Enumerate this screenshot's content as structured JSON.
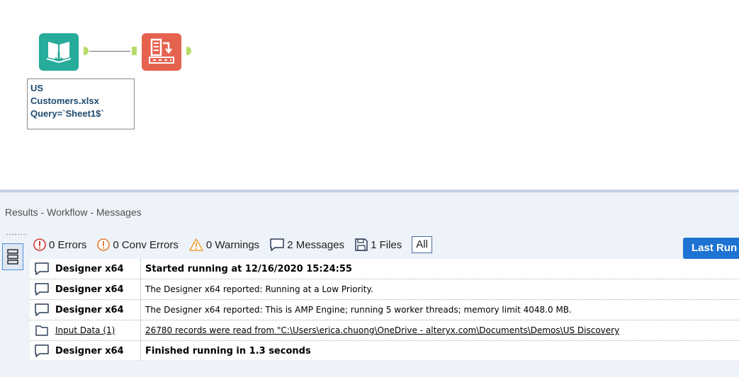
{
  "canvas": {
    "tools": [
      {
        "name": "input-data-tool",
        "color": "#27ab9a"
      },
      {
        "name": "select-tool",
        "color": "#e5624f"
      }
    ],
    "annotation": [
      "US",
      "Customers.xlsx",
      "Query=`Sheet1$`"
    ]
  },
  "results": {
    "title": "Results - Workflow - Messages",
    "filters": {
      "errors": "0 Errors",
      "conv_errors": "0 Conv Errors",
      "warnings": "0 Warnings",
      "messages": "2 Messages",
      "files": "1 Files",
      "all": "All"
    },
    "last_run": "Last Run",
    "rows": [
      {
        "icon": "message-icon",
        "tool": "Designer x64",
        "text": "Started running at 12/16/2020 15:24:55",
        "bold": true,
        "link": false
      },
      {
        "icon": "message-icon",
        "tool": "Designer x64",
        "text": "The Designer x64 reported: Running at a Low Priority.",
        "bold": false,
        "link": false
      },
      {
        "icon": "message-icon",
        "tool": "Designer x64",
        "text": "The Designer x64 reported: This is AMP Engine; running 5 worker threads; memory limit 4048.0 MB.",
        "bold": false,
        "link": false
      },
      {
        "icon": "folder-icon",
        "tool": "Input Data (1)",
        "text": "26780 records were read from \"C:\\Users\\erica.chuong\\OneDrive - alteryx.com\\Documents\\Demos\\US Discovery",
        "bold": false,
        "link": true
      },
      {
        "icon": "message-icon",
        "tool": "Designer x64",
        "text": "Finished running in 1.3 seconds",
        "bold": true,
        "link": false
      }
    ]
  },
  "colors": {
    "accent_blue": "#1e73d2",
    "input_tool": "#27ab9a",
    "select_tool": "#e5624f",
    "anchor_green": "#b6dc6a",
    "error_red": "#d03a2f",
    "warning_orange": "#e9a23b",
    "link_blue": "#1a3fd0"
  }
}
